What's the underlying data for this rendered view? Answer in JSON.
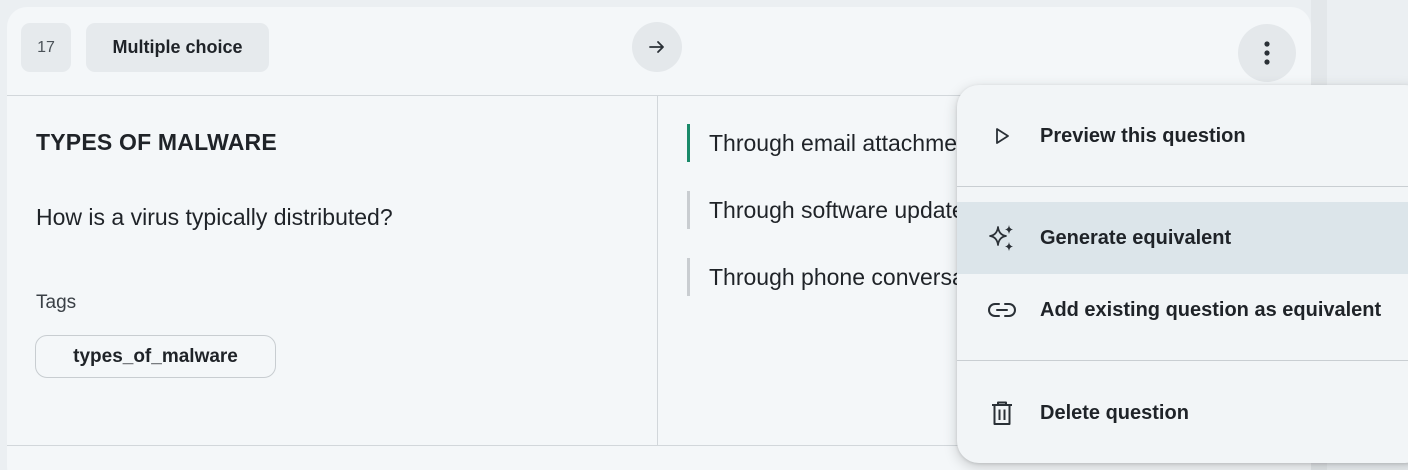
{
  "card": {
    "number": "17",
    "type_label": "Multiple choice",
    "category": "TYPES OF MALWARE",
    "question": "How is a virus typically distributed?",
    "tags_label": "Tags",
    "tags": [
      "types_of_malware"
    ]
  },
  "answers": [
    {
      "text": "Through email attachments",
      "correct": true
    },
    {
      "text": "Through software updates",
      "correct": false
    },
    {
      "text": "Through phone conversations",
      "correct": false
    }
  ],
  "menu": {
    "items": [
      {
        "label": "Preview this question",
        "icon": "play-icon"
      },
      {
        "label": "Generate equivalent",
        "icon": "sparkle-icon",
        "highlighted": true
      },
      {
        "label": "Add existing question as equivalent",
        "icon": "link-icon"
      },
      {
        "label": "Delete question",
        "icon": "trash-icon"
      }
    ]
  },
  "colors": {
    "correct_marker": "#1a8a6a",
    "menu_highlight": "#dce5ea"
  }
}
